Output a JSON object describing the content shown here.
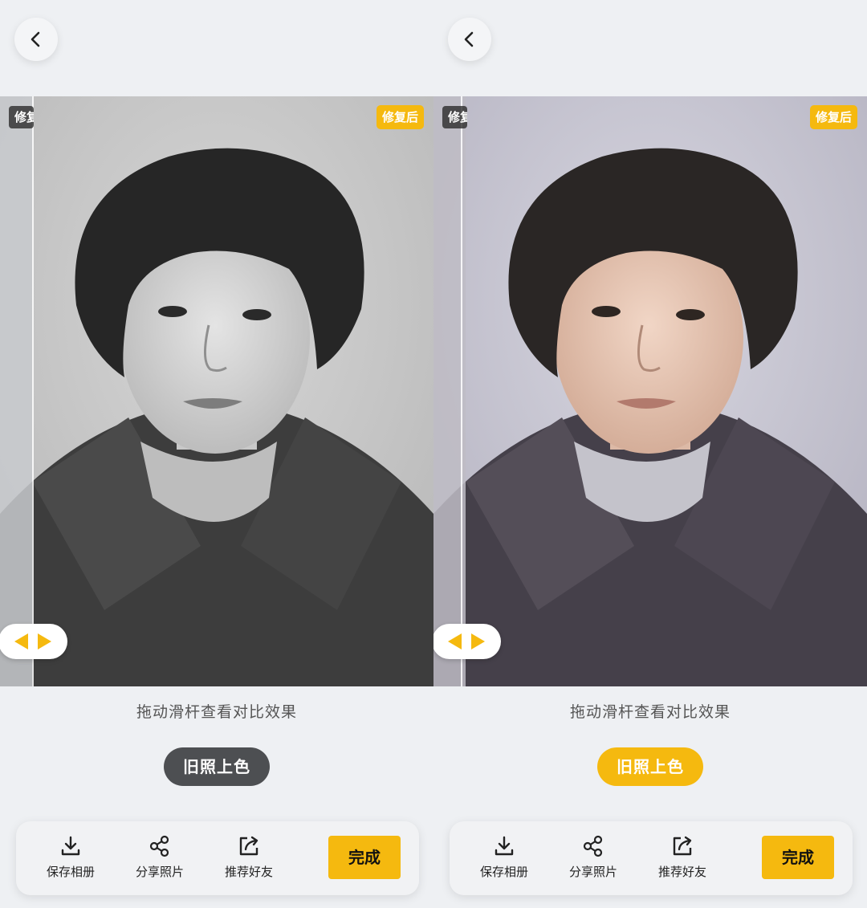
{
  "screens": [
    {
      "state": "before",
      "back_icon": "chevron-left-icon",
      "tag_before": "修复前",
      "tag_after": "修复后",
      "hint": "拖动滑杆查看对比效果",
      "mode_label": "旧照上色",
      "mode_active": false,
      "toolbar": {
        "save_label": "保存相册",
        "share_label": "分享照片",
        "recommend_label": "推荐好友",
        "done_label": "完成"
      }
    },
    {
      "state": "after",
      "back_icon": "chevron-left-icon",
      "tag_before": "修复前",
      "tag_after": "修复后",
      "hint": "拖动滑杆查看对比效果",
      "mode_label": "旧照上色",
      "mode_active": true,
      "toolbar": {
        "save_label": "保存相册",
        "share_label": "分享照片",
        "recommend_label": "推荐好友",
        "done_label": "完成"
      }
    }
  ],
  "colors": {
    "accent": "#f5b90f",
    "mode_inactive": "#4d4f52",
    "background": "#eef0f3"
  },
  "icons": {
    "save": "download-icon",
    "share": "share-icon",
    "recommend": "external-share-icon",
    "slider": "left-right-arrows-icon"
  }
}
